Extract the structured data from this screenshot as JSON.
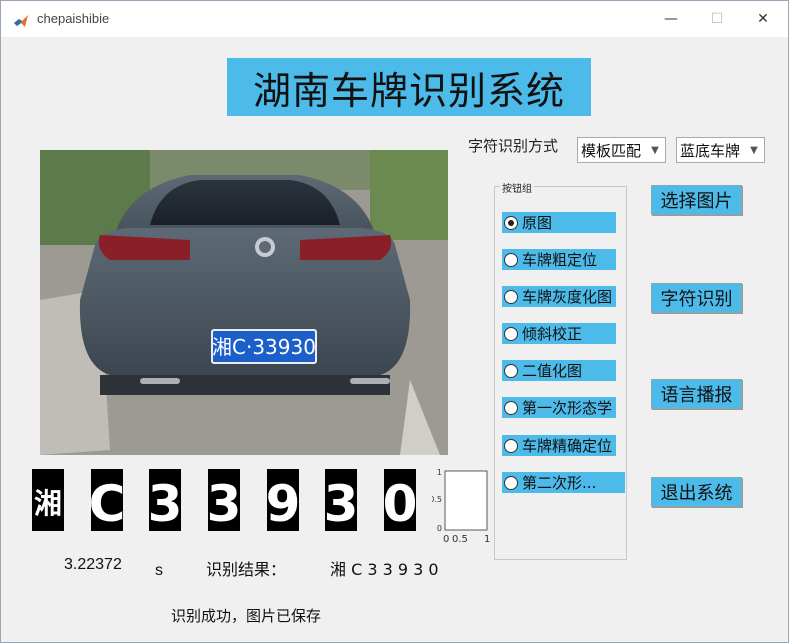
{
  "window": {
    "title": "chepaishibie",
    "minimize": "—",
    "maximize": "☐",
    "close": "✕"
  },
  "banner": {
    "title": "湖南车牌识别系统"
  },
  "recognition_mode": {
    "label": "字符识别方式",
    "method_selected": "模板匹配",
    "plate_type_selected": "蓝底车牌"
  },
  "radio_group": {
    "title": "按钮组",
    "selected_index": 0,
    "options": [
      "原图",
      "车牌粗定位",
      "车牌灰度化图",
      "倾斜校正",
      "二值化图",
      "第一次形态学",
      "车牌精确定位",
      "第二次形..."
    ]
  },
  "buttons": {
    "select_image": "选择图片",
    "recognize_chars": "字符识别",
    "voice_broadcast": "语言播报",
    "exit_system": "退出系统"
  },
  "photo": {
    "plate_text": "湘C·33930"
  },
  "segmented_chars": [
    "湘",
    "C",
    "3",
    "3",
    "9",
    "3",
    "0"
  ],
  "empty_axes": {
    "yticks": [
      "1",
      "0.5",
      "0"
    ],
    "xticks": [
      "0",
      "0.5",
      "1"
    ]
  },
  "results": {
    "time_value": "3.22372",
    "time_unit": "s",
    "result_label": "识别结果：",
    "result_value": "湘 C 3 3 9 3 0",
    "status_message": "识别成功，图片已保存"
  },
  "colors": {
    "accent": "#4dbbea"
  }
}
